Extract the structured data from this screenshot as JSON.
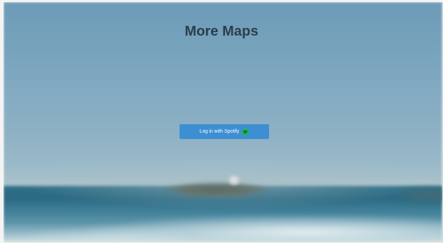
{
  "page": {
    "title": "More Maps"
  },
  "login": {
    "label": "Log in with Spotify",
    "icon": "spotify-icon",
    "button_color": "#3d8fd3",
    "icon_color": "#1db954"
  },
  "background": {
    "description_colors": {
      "sky": "#8fb2c5",
      "sea": "#2f6e86"
    }
  }
}
